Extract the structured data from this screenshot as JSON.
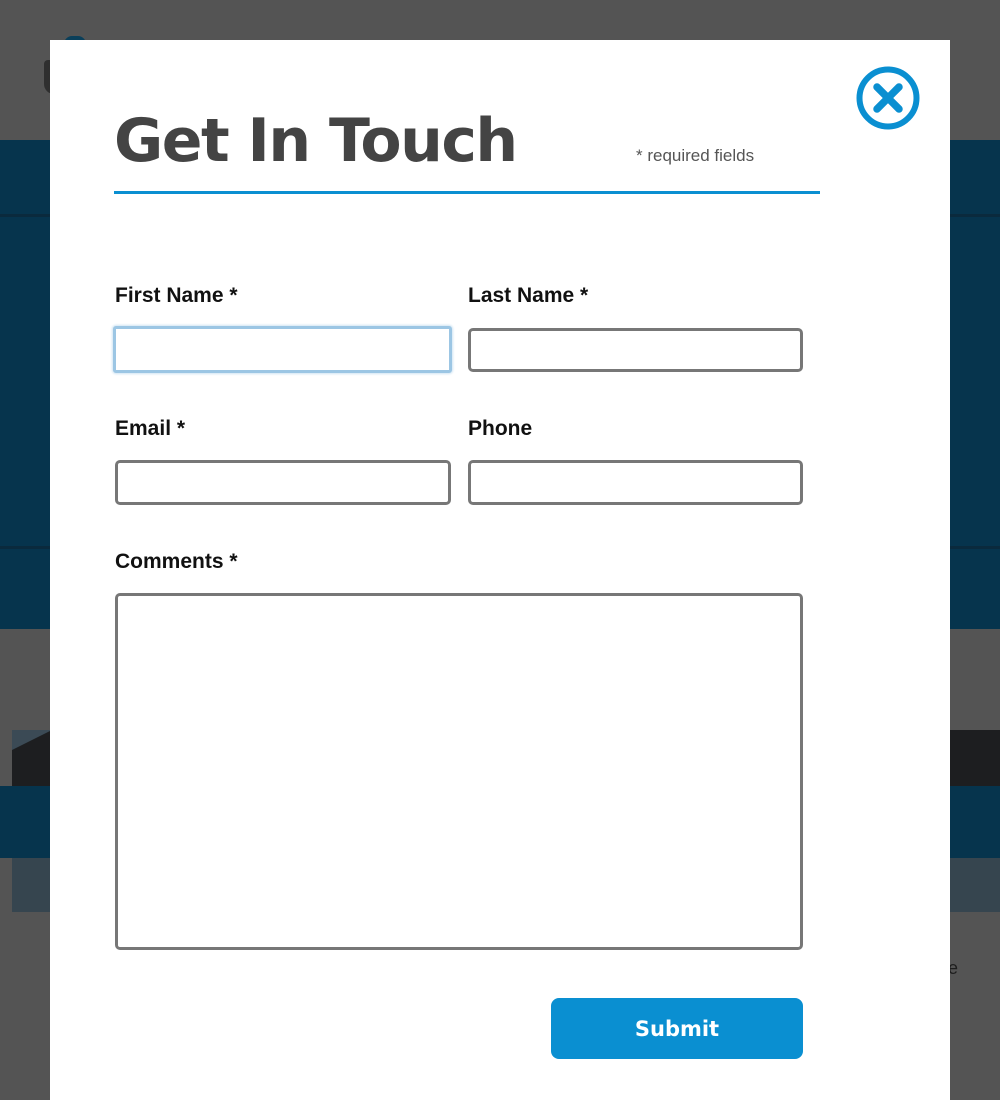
{
  "modal": {
    "title": "Get In Touch",
    "required_note": "* required fields",
    "close_icon": "close-circle-icon",
    "accent_color": "#0a8fd1"
  },
  "form": {
    "first_name": {
      "label": "First Name *",
      "value": "",
      "placeholder": ""
    },
    "last_name": {
      "label": "Last Name *",
      "value": "",
      "placeholder": ""
    },
    "email": {
      "label": "Email *",
      "value": "",
      "placeholder": ""
    },
    "phone": {
      "label": "Phone",
      "value": "",
      "placeholder": ""
    },
    "comments": {
      "label": "Comments *",
      "value": "",
      "placeholder": ""
    },
    "submit_label": "Submit"
  },
  "background": {
    "partial_text": "e"
  }
}
